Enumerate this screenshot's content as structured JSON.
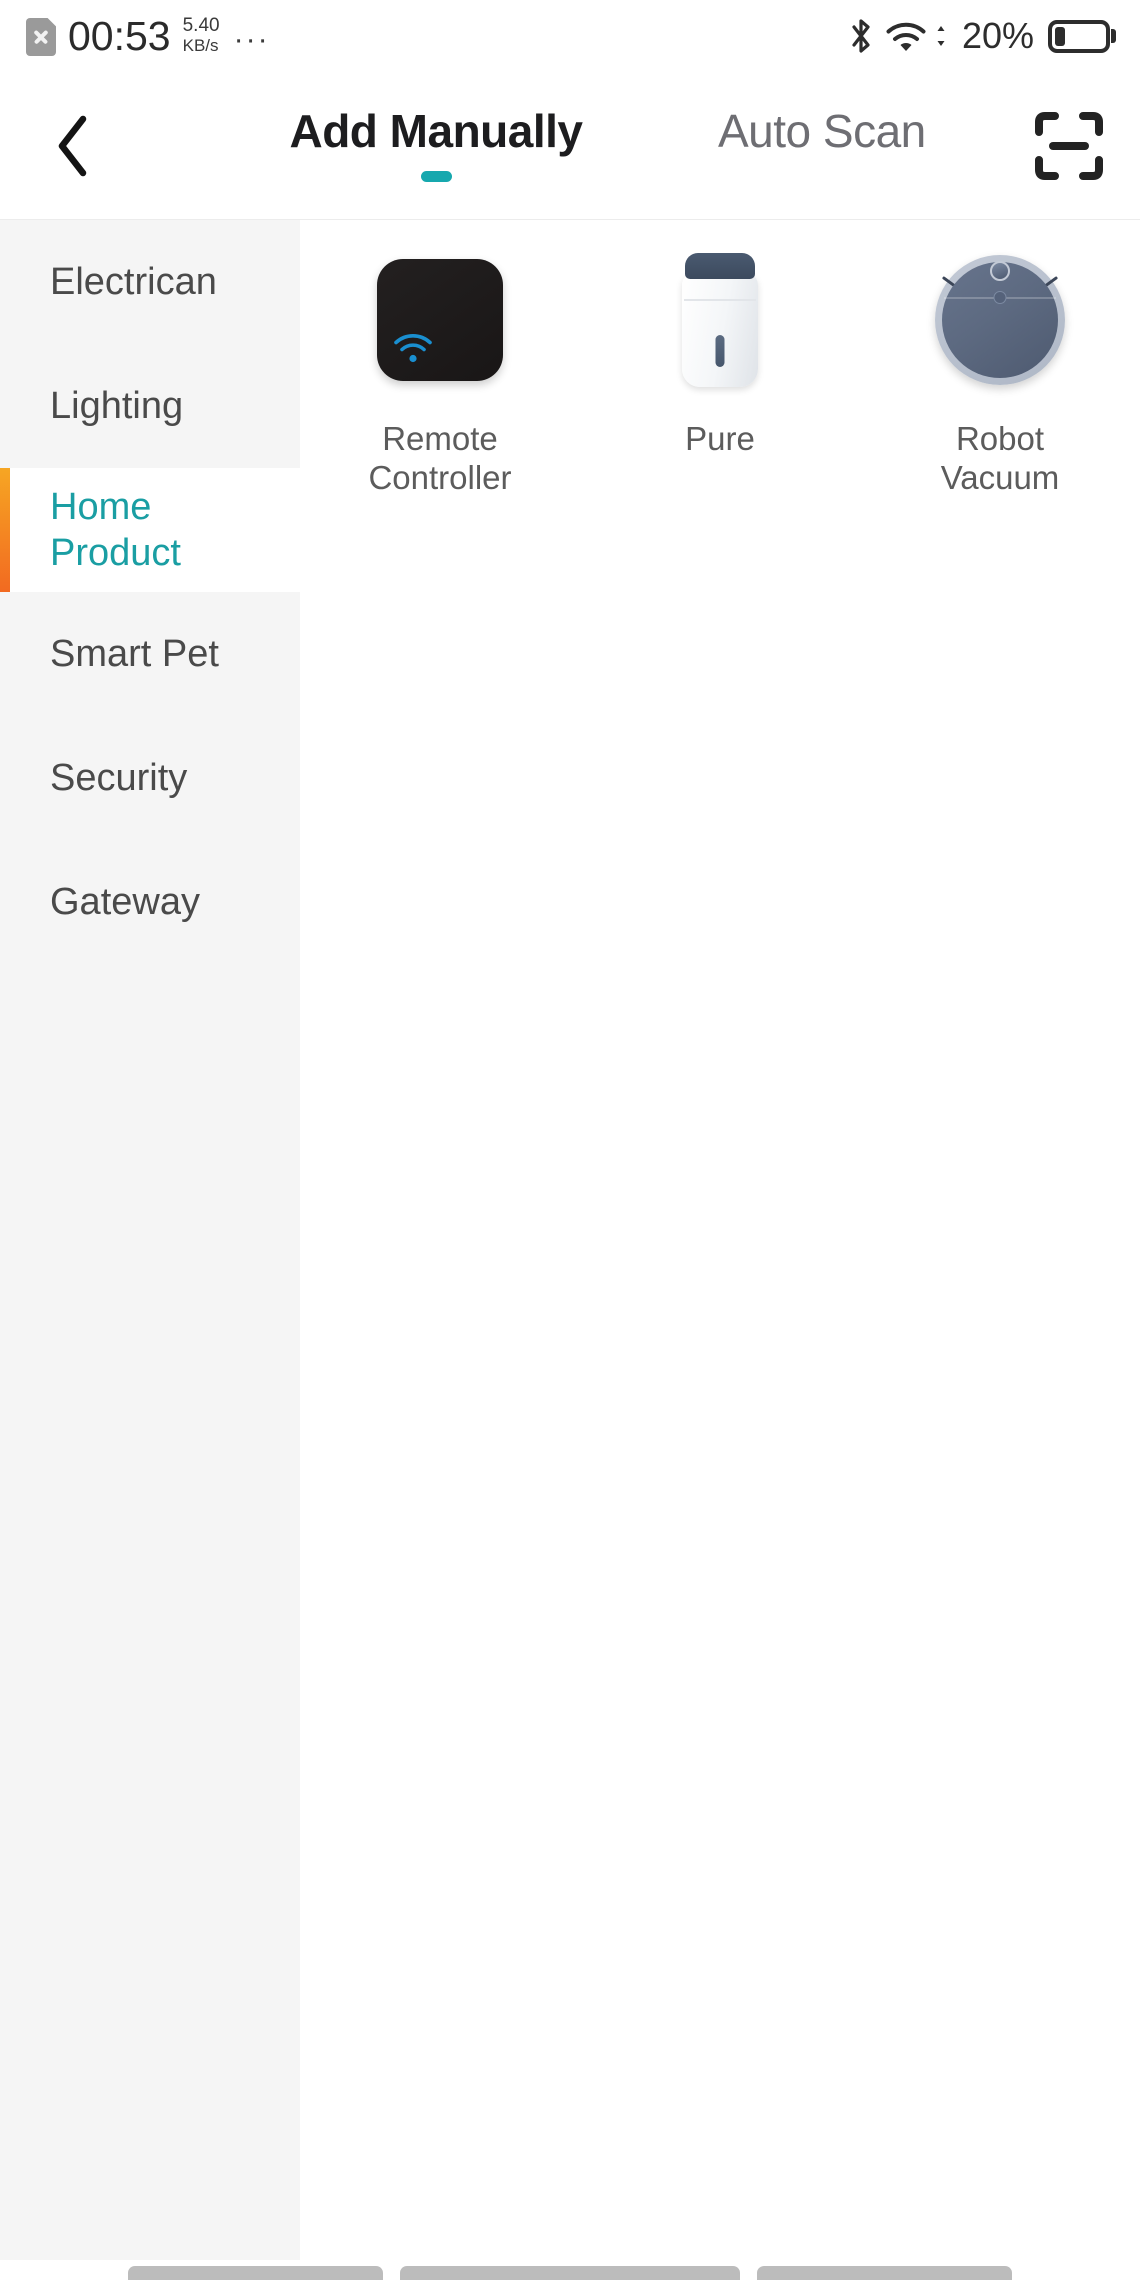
{
  "status_bar": {
    "sim_icon": "sim-card-disabled-icon",
    "time": "00:53",
    "net_speed_value": "5.40",
    "net_speed_unit": "KB/s",
    "overflow": "···",
    "bluetooth_icon": "bluetooth-icon",
    "wifi_icon": "wifi-icon",
    "battery_percent": "20%",
    "battery_level": 20,
    "battery_icon": "battery-icon"
  },
  "header": {
    "back_icon": "chevron-left-icon",
    "tabs": [
      {
        "label": "Add Manually",
        "active": true
      },
      {
        "label": "Auto Scan",
        "active": false
      }
    ],
    "indicator_color": "#16a8ae",
    "scan_icon": "scan-frame-icon"
  },
  "sidebar": {
    "background": "#f5f5f5",
    "active_color": "#1a9ea3",
    "accent_color": "#f5921f",
    "items": [
      {
        "label": "Electrican",
        "active": false
      },
      {
        "label": "Lighting",
        "active": false
      },
      {
        "label": "Home Product",
        "active": true
      },
      {
        "label": "Smart Pet",
        "active": false
      },
      {
        "label": "Security",
        "active": false
      },
      {
        "label": "Gateway",
        "active": false
      }
    ]
  },
  "content": {
    "products": [
      {
        "name": "Remote Controller",
        "art": "remote-controller-icon"
      },
      {
        "name": "Pure",
        "art": "air-purifier-icon"
      },
      {
        "name": "Robot Vacuum",
        "art": "robot-vacuum-icon"
      }
    ]
  },
  "nav_bar": {
    "segments": 3
  }
}
